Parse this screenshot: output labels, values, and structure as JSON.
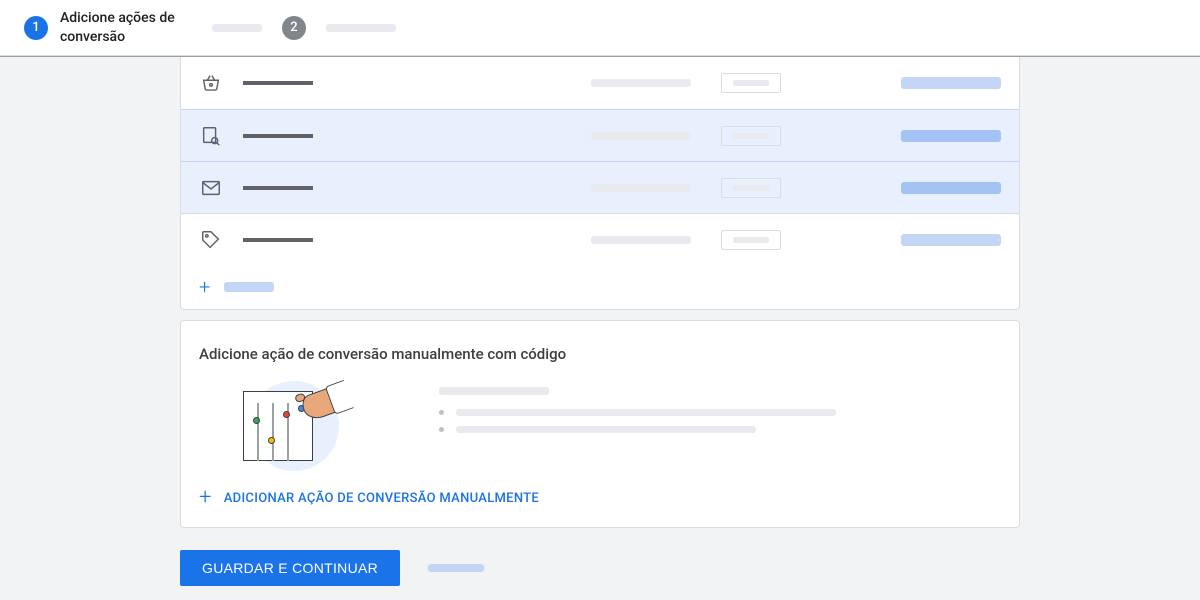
{
  "stepper": {
    "step1": {
      "num": "1",
      "label": "Adicione ações de conversão"
    },
    "step2": {
      "num": "2"
    }
  },
  "rows": [
    {
      "icon": "basket",
      "selected": false
    },
    {
      "icon": "search-page",
      "selected": true
    },
    {
      "icon": "mail",
      "selected": true
    },
    {
      "icon": "tag",
      "selected": false
    }
  ],
  "add_row_label": "",
  "manual_card": {
    "title": "Adicione ação de conversão manualmente com código",
    "link_label": "ADICIONAR AÇÃO DE CONVERSÃO MANUALMENTE"
  },
  "footer": {
    "primary": "GUARDAR E CONTINUAR"
  }
}
